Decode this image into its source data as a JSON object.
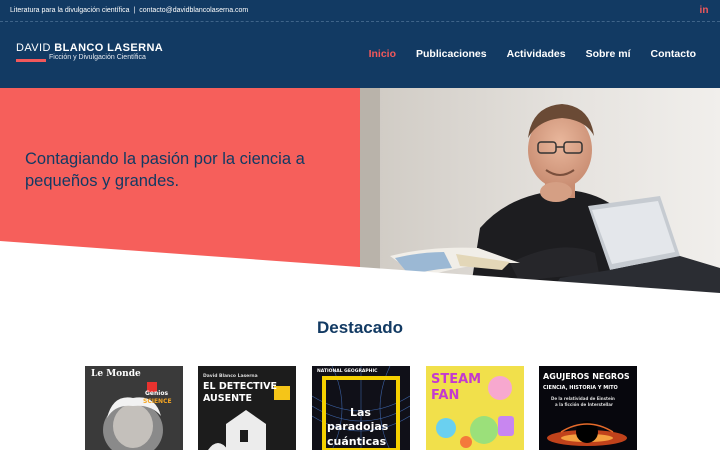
{
  "topbar": {
    "text_left": "Literatura para la divulgación científica",
    "separator": "|",
    "email": "contacto@davidblancolaserna.com",
    "social_icon": "linkedin-icon",
    "social_label": "in"
  },
  "header": {
    "logo_first": "DAVID ",
    "logo_last": "BLANCO LASERNA",
    "logo_tagline": "Ficción y Divulgación Científica",
    "nav": [
      "Inicio",
      "Publicaciones",
      "Actividades",
      "Sobre mí",
      "Contacto"
    ],
    "active_nav": "Inicio"
  },
  "hero": {
    "headline": "Contagiando la pasión por la ciencia a pequeños y grandes."
  },
  "featured": {
    "title": "Destacado",
    "books": [
      {
        "cover_lines": [
          "Le Monde",
          "Genios",
          "SCIENCE"
        ]
      },
      {
        "cover_lines": [
          "David Blanco Laserna",
          "EL DETECTIVE",
          "AUSENTE"
        ]
      },
      {
        "cover_lines": [
          "NATIONAL GEOGRAPHIC",
          "Las",
          "paradojas",
          "cuánticas"
        ]
      },
      {
        "cover_lines": [
          "STEAM",
          "FAN"
        ]
      },
      {
        "cover_lines": [
          "AGUJEROS NEGROS",
          "CIENCIA, HISTORIA Y MITO",
          "De la relatividad de Einstein",
          "a la ficción de Interstellar"
        ]
      }
    ]
  },
  "colors": {
    "navy": "#123a63",
    "coral": "#f65f5b",
    "accent": "#f2585b"
  }
}
